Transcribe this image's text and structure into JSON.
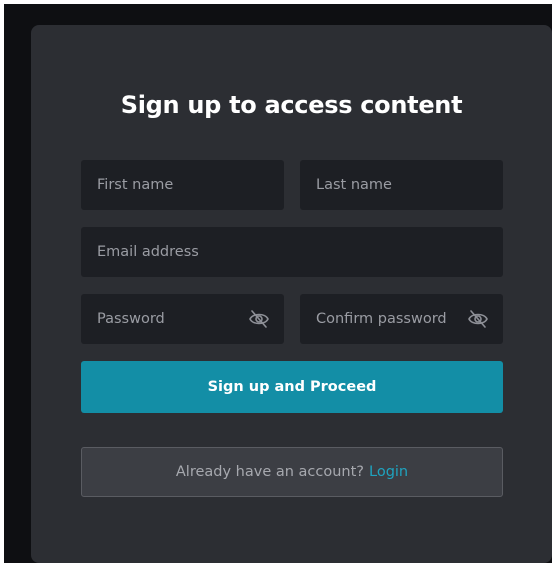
{
  "form": {
    "title": "Sign up to access content",
    "first_name_placeholder": "First name",
    "last_name_placeholder": "Last name",
    "email_placeholder": "Email address",
    "password_placeholder": "Password",
    "confirm_password_placeholder": "Confirm password",
    "submit_label": "Sign up and Proceed",
    "login_prompt": "Already have an account?",
    "login_link": "Login"
  },
  "icons": {
    "password_toggle": "eye-off-icon",
    "confirm_password_toggle": "eye-off-icon"
  },
  "colors": {
    "background": "#0e0f12",
    "card": "#2c2e33",
    "field": "#1d1f24",
    "primary": "#138ea6",
    "link": "#1fa3bf"
  }
}
